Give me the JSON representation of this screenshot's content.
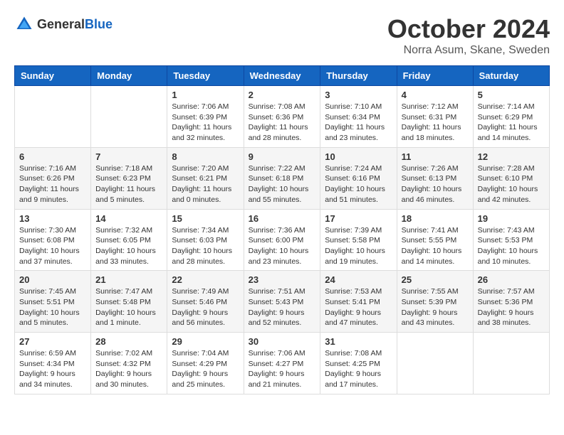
{
  "header": {
    "logo_general": "General",
    "logo_blue": "Blue",
    "month_title": "October 2024",
    "location": "Norra Asum, Skane, Sweden"
  },
  "weekdays": [
    "Sunday",
    "Monday",
    "Tuesday",
    "Wednesday",
    "Thursday",
    "Friday",
    "Saturday"
  ],
  "weeks": [
    [
      {
        "day": "",
        "info": ""
      },
      {
        "day": "",
        "info": ""
      },
      {
        "day": "1",
        "info": "Sunrise: 7:06 AM\nSunset: 6:39 PM\nDaylight: 11 hours and 32 minutes."
      },
      {
        "day": "2",
        "info": "Sunrise: 7:08 AM\nSunset: 6:36 PM\nDaylight: 11 hours and 28 minutes."
      },
      {
        "day": "3",
        "info": "Sunrise: 7:10 AM\nSunset: 6:34 PM\nDaylight: 11 hours and 23 minutes."
      },
      {
        "day": "4",
        "info": "Sunrise: 7:12 AM\nSunset: 6:31 PM\nDaylight: 11 hours and 18 minutes."
      },
      {
        "day": "5",
        "info": "Sunrise: 7:14 AM\nSunset: 6:29 PM\nDaylight: 11 hours and 14 minutes."
      }
    ],
    [
      {
        "day": "6",
        "info": "Sunrise: 7:16 AM\nSunset: 6:26 PM\nDaylight: 11 hours and 9 minutes."
      },
      {
        "day": "7",
        "info": "Sunrise: 7:18 AM\nSunset: 6:23 PM\nDaylight: 11 hours and 5 minutes."
      },
      {
        "day": "8",
        "info": "Sunrise: 7:20 AM\nSunset: 6:21 PM\nDaylight: 11 hours and 0 minutes."
      },
      {
        "day": "9",
        "info": "Sunrise: 7:22 AM\nSunset: 6:18 PM\nDaylight: 10 hours and 55 minutes."
      },
      {
        "day": "10",
        "info": "Sunrise: 7:24 AM\nSunset: 6:16 PM\nDaylight: 10 hours and 51 minutes."
      },
      {
        "day": "11",
        "info": "Sunrise: 7:26 AM\nSunset: 6:13 PM\nDaylight: 10 hours and 46 minutes."
      },
      {
        "day": "12",
        "info": "Sunrise: 7:28 AM\nSunset: 6:10 PM\nDaylight: 10 hours and 42 minutes."
      }
    ],
    [
      {
        "day": "13",
        "info": "Sunrise: 7:30 AM\nSunset: 6:08 PM\nDaylight: 10 hours and 37 minutes."
      },
      {
        "day": "14",
        "info": "Sunrise: 7:32 AM\nSunset: 6:05 PM\nDaylight: 10 hours and 33 minutes."
      },
      {
        "day": "15",
        "info": "Sunrise: 7:34 AM\nSunset: 6:03 PM\nDaylight: 10 hours and 28 minutes."
      },
      {
        "day": "16",
        "info": "Sunrise: 7:36 AM\nSunset: 6:00 PM\nDaylight: 10 hours and 23 minutes."
      },
      {
        "day": "17",
        "info": "Sunrise: 7:39 AM\nSunset: 5:58 PM\nDaylight: 10 hours and 19 minutes."
      },
      {
        "day": "18",
        "info": "Sunrise: 7:41 AM\nSunset: 5:55 PM\nDaylight: 10 hours and 14 minutes."
      },
      {
        "day": "19",
        "info": "Sunrise: 7:43 AM\nSunset: 5:53 PM\nDaylight: 10 hours and 10 minutes."
      }
    ],
    [
      {
        "day": "20",
        "info": "Sunrise: 7:45 AM\nSunset: 5:51 PM\nDaylight: 10 hours and 5 minutes."
      },
      {
        "day": "21",
        "info": "Sunrise: 7:47 AM\nSunset: 5:48 PM\nDaylight: 10 hours and 1 minute."
      },
      {
        "day": "22",
        "info": "Sunrise: 7:49 AM\nSunset: 5:46 PM\nDaylight: 9 hours and 56 minutes."
      },
      {
        "day": "23",
        "info": "Sunrise: 7:51 AM\nSunset: 5:43 PM\nDaylight: 9 hours and 52 minutes."
      },
      {
        "day": "24",
        "info": "Sunrise: 7:53 AM\nSunset: 5:41 PM\nDaylight: 9 hours and 47 minutes."
      },
      {
        "day": "25",
        "info": "Sunrise: 7:55 AM\nSunset: 5:39 PM\nDaylight: 9 hours and 43 minutes."
      },
      {
        "day": "26",
        "info": "Sunrise: 7:57 AM\nSunset: 5:36 PM\nDaylight: 9 hours and 38 minutes."
      }
    ],
    [
      {
        "day": "27",
        "info": "Sunrise: 6:59 AM\nSunset: 4:34 PM\nDaylight: 9 hours and 34 minutes."
      },
      {
        "day": "28",
        "info": "Sunrise: 7:02 AM\nSunset: 4:32 PM\nDaylight: 9 hours and 30 minutes."
      },
      {
        "day": "29",
        "info": "Sunrise: 7:04 AM\nSunset: 4:29 PM\nDaylight: 9 hours and 25 minutes."
      },
      {
        "day": "30",
        "info": "Sunrise: 7:06 AM\nSunset: 4:27 PM\nDaylight: 9 hours and 21 minutes."
      },
      {
        "day": "31",
        "info": "Sunrise: 7:08 AM\nSunset: 4:25 PM\nDaylight: 9 hours and 17 minutes."
      },
      {
        "day": "",
        "info": ""
      },
      {
        "day": "",
        "info": ""
      }
    ]
  ]
}
